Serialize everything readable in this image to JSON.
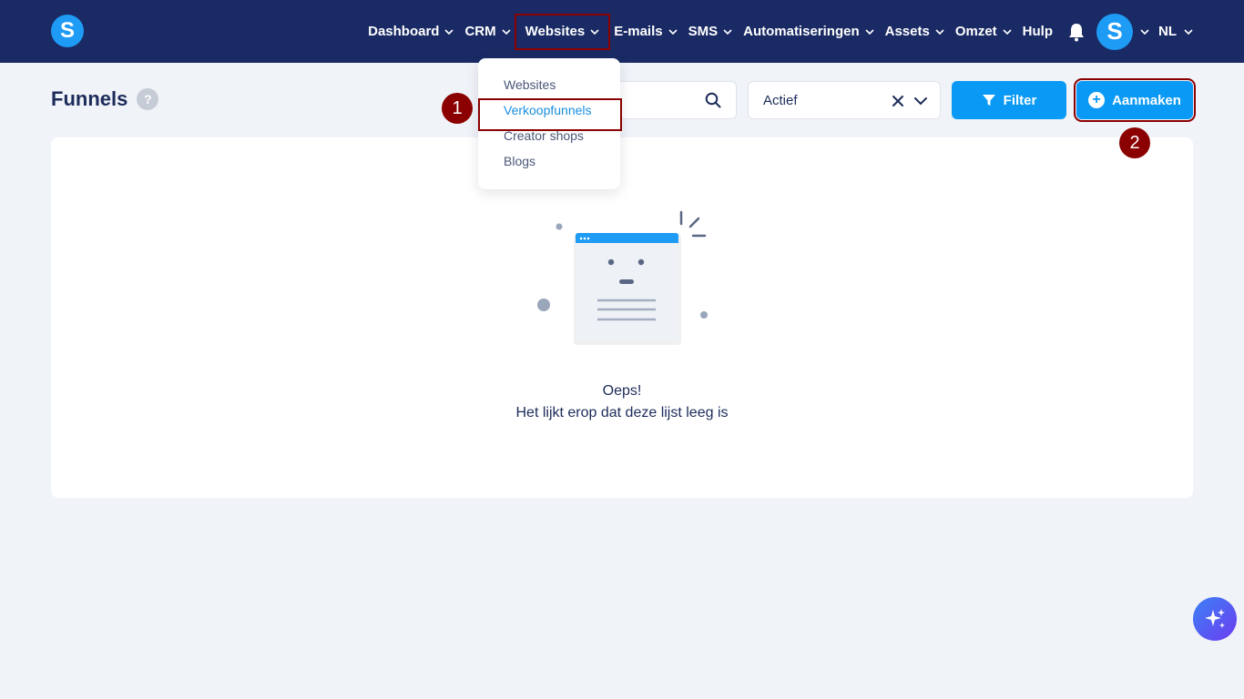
{
  "app": {
    "logo_letter": "S"
  },
  "nav": {
    "items": [
      {
        "label": "Dashboard"
      },
      {
        "label": "CRM"
      },
      {
        "label": "Websites"
      },
      {
        "label": "E-mails"
      },
      {
        "label": "SMS"
      },
      {
        "label": "Automatiseringen"
      },
      {
        "label": "Assets"
      },
      {
        "label": "Omzet"
      }
    ],
    "help_label": "Hulp",
    "avatar_letter": "S",
    "language": "NL"
  },
  "websites_menu": {
    "items": [
      {
        "label": "Websites"
      },
      {
        "label": "Verkoopfunnels"
      },
      {
        "label": "Creator shops"
      },
      {
        "label": "Blogs"
      }
    ],
    "selected": "Verkoopfunnels"
  },
  "page": {
    "title": "Funnels",
    "help_icon": "?"
  },
  "toolbar": {
    "search_placeholder": "",
    "status_value": "Actief",
    "filter_label": "Filter",
    "create_label": "Aanmaken"
  },
  "empty_state": {
    "title": "Oeps!",
    "message": "Het lijkt erop dat deze lijst leeg is"
  },
  "annotations": {
    "step1": "1",
    "step2": "2"
  },
  "colors": {
    "topbar": "#1a2a64",
    "primary": "#0a9af5",
    "annotation": "#8b0000",
    "background": "#f0f3f8"
  }
}
